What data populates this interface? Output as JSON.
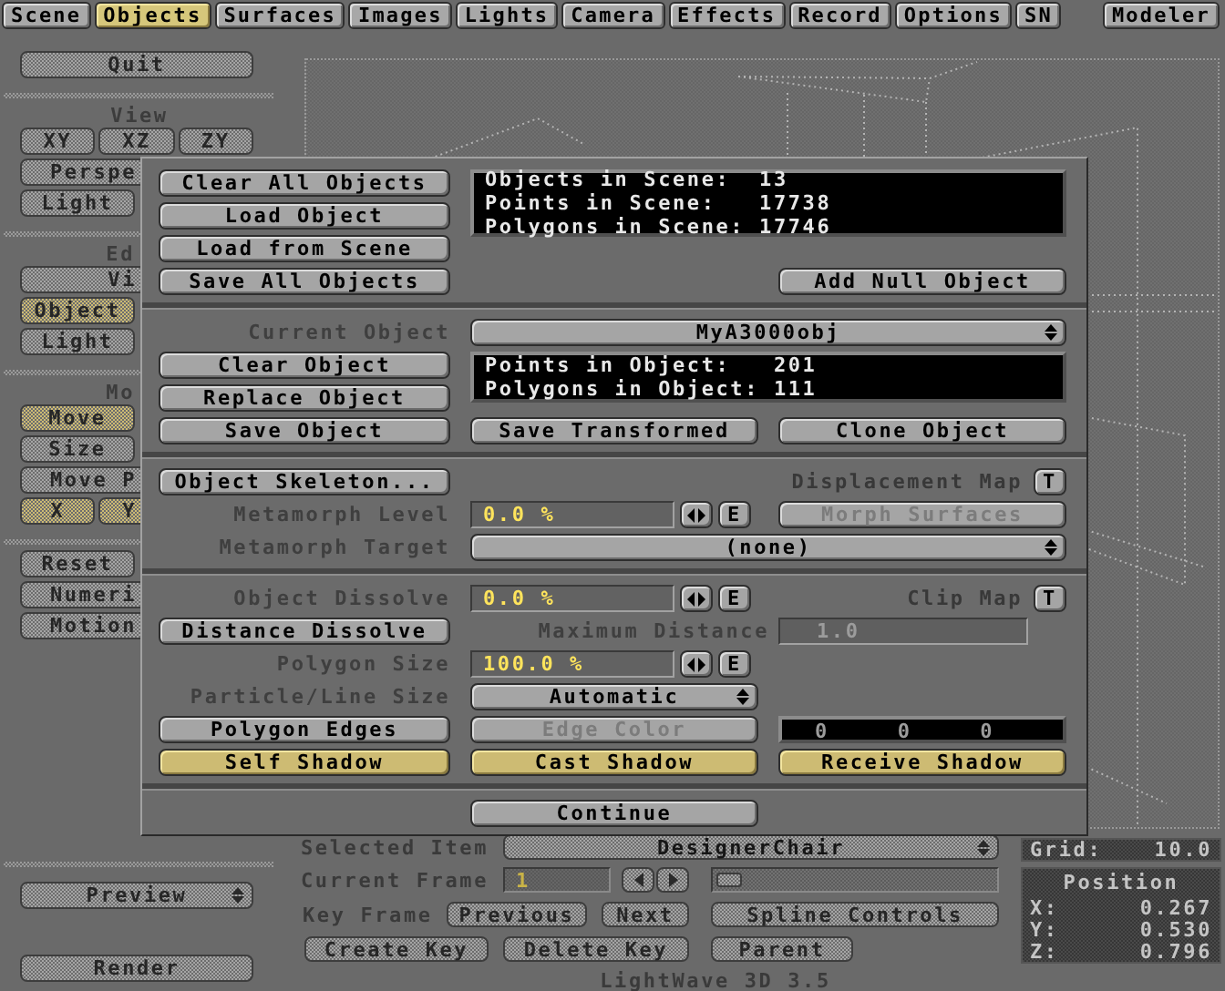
{
  "tabs": [
    {
      "label": "Scene",
      "selected": false
    },
    {
      "label": "Objects",
      "selected": true
    },
    {
      "label": "Surfaces",
      "selected": false
    },
    {
      "label": "Images",
      "selected": false
    },
    {
      "label": "Lights",
      "selected": false
    },
    {
      "label": "Camera",
      "selected": false
    },
    {
      "label": "Effects",
      "selected": false
    },
    {
      "label": "Record",
      "selected": false
    },
    {
      "label": "Options",
      "selected": false
    },
    {
      "label": "SN",
      "selected": false
    }
  ],
  "modeler_button": "Modeler",
  "sidebar": {
    "groups": [
      {
        "rows": [
          [
            {
              "label": "Quit",
              "kind": "wide",
              "selected": false
            }
          ]
        ]
      },
      {
        "heading": "View",
        "rows": [
          [
            {
              "label": "XY",
              "kind": "third",
              "selected": false
            },
            {
              "label": "XZ",
              "kind": "third",
              "selected": false
            },
            {
              "label": "ZY",
              "kind": "third",
              "selected": false
            }
          ],
          [
            {
              "label": "Perspe",
              "kind": "wide",
              "selected": false
            }
          ],
          [
            {
              "label": "Light",
              "kind": "half",
              "selected": false
            }
          ]
        ]
      },
      {
        "heading": "Ed",
        "rows": [
          [
            {
              "label": "Vi",
              "kind": "wide",
              "selected": false
            }
          ],
          [
            {
              "label": "Object",
              "kind": "half",
              "selected": true
            }
          ],
          [
            {
              "label": "Light",
              "kind": "half",
              "selected": false
            }
          ]
        ]
      },
      {
        "heading": "Mo",
        "rows": [
          [
            {
              "label": "Move",
              "kind": "half",
              "selected": true
            }
          ],
          [
            {
              "label": "Size",
              "kind": "half",
              "selected": false
            }
          ],
          [
            {
              "label": "Move P",
              "kind": "wide",
              "selected": false
            }
          ],
          [
            {
              "label": "X",
              "kind": "third",
              "selected": true
            },
            {
              "label": "Y",
              "kind": "third",
              "selected": true
            }
          ]
        ]
      },
      {
        "rows": [
          [
            {
              "label": "Reset",
              "kind": "half",
              "selected": false
            }
          ],
          [
            {
              "label": "Numeri",
              "kind": "wide",
              "selected": false
            }
          ],
          [
            {
              "label": "Motion",
              "kind": "wide",
              "selected": false
            }
          ]
        ]
      }
    ],
    "preview_menu": "Preview",
    "render_button": "Render"
  },
  "object_panel": {
    "scene_buttons": [
      "Clear All Objects",
      "Load Object",
      "Load from Scene",
      "Save All Objects"
    ],
    "scene_info": [
      "Objects in Scene:  13",
      "Points in Scene:   17738",
      "Polygons in Scene: 17746"
    ],
    "add_null_button": "Add Null Object",
    "current_object": {
      "label": "Current Object",
      "value": "MyA3000obj"
    },
    "object_buttons": [
      "Clear Object",
      "Replace Object"
    ],
    "object_info": [
      "Points in Object:   201",
      "Polygons in Object: 111"
    ],
    "save_buttons": [
      "Save Object",
      "Save Transformed",
      "Clone Object"
    ],
    "skeleton_button": "Object Skeleton...",
    "displacement_map": {
      "label": "Displacement Map",
      "button": "T"
    },
    "metamorph_level": {
      "label": "Metamorph Level",
      "value": "0.0 %",
      "envelope_button": "E"
    },
    "morph_surfaces": {
      "label": "Morph Surfaces",
      "disabled": true
    },
    "metamorph_target": {
      "label": "Metamorph Target",
      "value": "(none)"
    },
    "object_dissolve": {
      "label": "Object Dissolve",
      "value": "0.0 %",
      "envelope_button": "E"
    },
    "clip_map": {
      "label": "Clip Map",
      "button": "T"
    },
    "distance_dissolve": {
      "label": "Distance Dissolve",
      "on": false
    },
    "maximum_distance": {
      "label": "Maximum Distance",
      "value": "1.0",
      "disabled": true
    },
    "polygon_size": {
      "label": "Polygon Size",
      "value": "100.0 %",
      "envelope_button": "E"
    },
    "particle_line_size": {
      "label": "Particle/Line Size",
      "value": "Automatic"
    },
    "polygon_edges": {
      "label": "Polygon Edges",
      "on": false
    },
    "edge_color": {
      "label": "Edge Color",
      "disabled": true,
      "values": [
        "0",
        "0",
        "0"
      ]
    },
    "shadows": [
      {
        "label": "Self Shadow",
        "on": true
      },
      {
        "label": "Cast Shadow",
        "on": true
      },
      {
        "label": "Receive Shadow",
        "on": true
      }
    ],
    "continue_button": "Continue"
  },
  "selected_item": {
    "label": "Selected Item",
    "value": "DesignerChair"
  },
  "current_frame": {
    "label": "Current Frame",
    "value": "1"
  },
  "frame_slider": {
    "level": 0
  },
  "key_frame": {
    "label": "Key Frame",
    "buttons": [
      "Previous",
      "Next"
    ]
  },
  "spline_controls_button": "Spline Controls",
  "key_buttons": [
    "Create Key",
    "Delete Key",
    "Parent"
  ],
  "grid": {
    "label": "Grid:",
    "value": "10.0"
  },
  "position": {
    "title": "Position",
    "axes": [
      {
        "label": "X:",
        "value": "0.267"
      },
      {
        "label": "Y:",
        "value": "0.530"
      },
      {
        "label": "Z:",
        "value": "0.796"
      }
    ]
  },
  "version": "LightWave 3D 3.5"
}
